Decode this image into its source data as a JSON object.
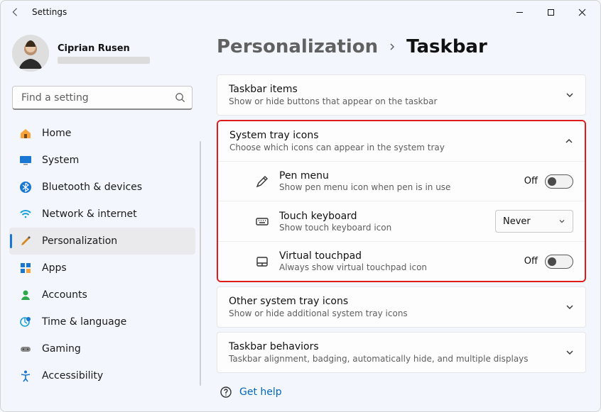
{
  "titlebar": {
    "title": "Settings"
  },
  "account": {
    "name": "Ciprian Rusen"
  },
  "search": {
    "placeholder": "Find a setting"
  },
  "sidebar": {
    "items": [
      {
        "label": "Home"
      },
      {
        "label": "System"
      },
      {
        "label": "Bluetooth & devices"
      },
      {
        "label": "Network & internet"
      },
      {
        "label": "Personalization"
      },
      {
        "label": "Apps"
      },
      {
        "label": "Accounts"
      },
      {
        "label": "Time & language"
      },
      {
        "label": "Gaming"
      },
      {
        "label": "Accessibility"
      }
    ]
  },
  "breadcrumb": {
    "parent": "Personalization",
    "current": "Taskbar"
  },
  "sections": {
    "taskbar_items": {
      "title": "Taskbar items",
      "subtitle": "Show or hide buttons that appear on the taskbar"
    },
    "system_tray": {
      "title": "System tray icons",
      "subtitle": "Choose which icons can appear in the system tray",
      "rows": [
        {
          "title": "Pen menu",
          "subtitle": "Show pen menu icon when pen is in use",
          "state_label": "Off"
        },
        {
          "title": "Touch keyboard",
          "subtitle": "Show touch keyboard icon",
          "dropdown_value": "Never"
        },
        {
          "title": "Virtual touchpad",
          "subtitle": "Always show virtual touchpad icon",
          "state_label": "Off"
        }
      ]
    },
    "other_tray": {
      "title": "Other system tray icons",
      "subtitle": "Show or hide additional system tray icons"
    },
    "behaviors": {
      "title": "Taskbar behaviors",
      "subtitle": "Taskbar alignment, badging, automatically hide, and multiple displays"
    }
  },
  "footer": {
    "help": "Get help"
  }
}
